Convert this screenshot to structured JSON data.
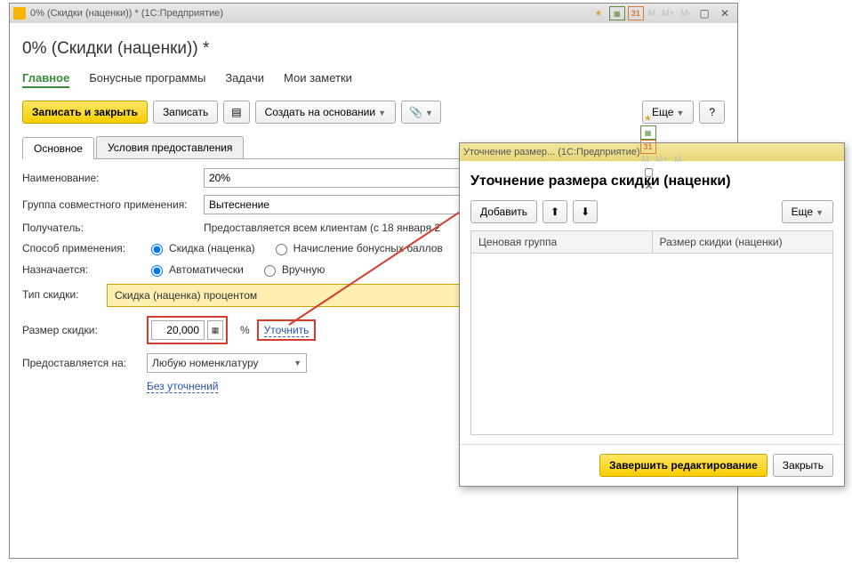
{
  "mainWindow": {
    "titleBar": "0% (Скидки (наценки)) *   (1С:Предприятие)",
    "pageTitle": "0% (Скидки (наценки)) *",
    "nav": {
      "main": "Главное",
      "bonus": "Бонусные программы",
      "tasks": "Задачи",
      "notes": "Мои заметки"
    },
    "toolbar": {
      "saveClose": "Записать и закрыть",
      "save": "Записать",
      "createBased": "Создать на основании",
      "more": "Еще",
      "help": "?"
    },
    "subTabs": {
      "main": "Основное",
      "conditions": "Условия предоставления"
    },
    "form": {
      "nameLabel": "Наименование:",
      "nameValue": "20%",
      "groupLabel": "Группа совместного применения:",
      "groupValue": "Вытеснение",
      "recipientLabel": "Получатель:",
      "recipientValue": "Предоставляется всем клиентам (с 18 января 2",
      "methodLabel": "Способ применения:",
      "methodOpt1": "Скидка (наценка)",
      "methodOpt2": "Начисление бонусных баллов",
      "assignLabel": "Назначается:",
      "assignOpt1": "Автоматически",
      "assignOpt2": "Вручную",
      "typeLabel": "Тип скидки:",
      "typeValue": "Скидка (наценка) процентом",
      "sizeLabel": "Размер скидки:",
      "sizeValue": "20,000",
      "percentSign": "%",
      "clarifyLink": "Уточнить",
      "providedLabel": "Предоставляется на:",
      "providedValue": "Любую номенклатуру",
      "noClarif": "Без уточнений"
    }
  },
  "modal": {
    "titleBar": "Уточнение размер...   (1С:Предприятие)",
    "heading": "Уточнение размера скидки (наценки)",
    "toolbar": {
      "add": "Добавить",
      "more": "Еще"
    },
    "table": {
      "col1": "Ценовая группа",
      "col2": "Размер скидки (наценки)"
    },
    "footer": {
      "finish": "Завершить редактирование",
      "close": "Закрыть"
    }
  },
  "mLabels": {
    "m": "M",
    "mp": "M+",
    "mm": "M-"
  }
}
